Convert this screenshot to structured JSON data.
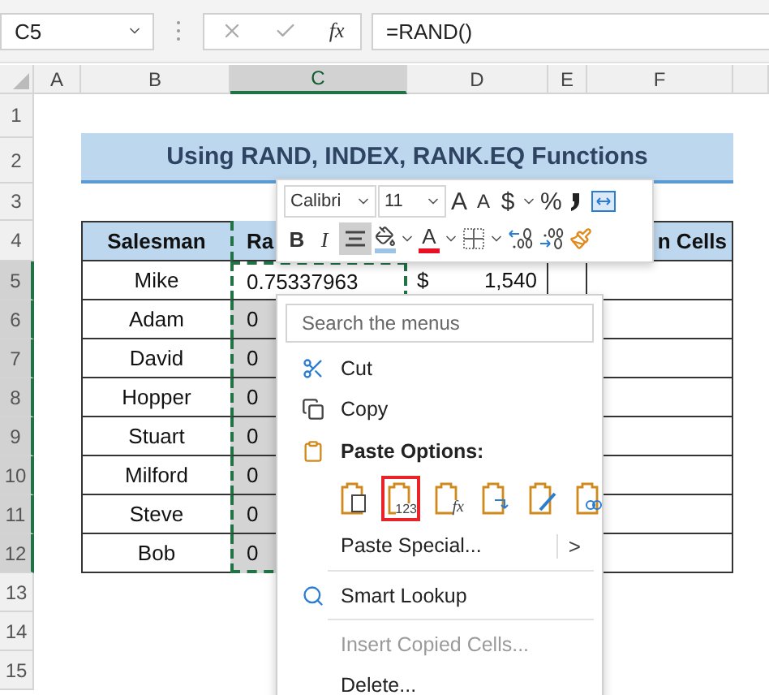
{
  "formula_bar": {
    "name_box": "C5",
    "function_label": "fx",
    "formula": "=RAND()"
  },
  "columns": [
    {
      "label": "A",
      "selected": false
    },
    {
      "label": "B",
      "selected": false
    },
    {
      "label": "C",
      "selected": true
    },
    {
      "label": "D",
      "selected": false
    },
    {
      "label": "E",
      "selected": false
    },
    {
      "label": "F",
      "selected": false
    }
  ],
  "rows": [
    {
      "label": "1",
      "selected": false
    },
    {
      "label": "2",
      "selected": false
    },
    {
      "label": "3",
      "selected": false
    },
    {
      "label": "4",
      "selected": false
    },
    {
      "label": "5",
      "selected": true
    },
    {
      "label": "6",
      "selected": true
    },
    {
      "label": "7",
      "selected": true
    },
    {
      "label": "8",
      "selected": true
    },
    {
      "label": "9",
      "selected": true
    },
    {
      "label": "10",
      "selected": true
    },
    {
      "label": "11",
      "selected": true
    },
    {
      "label": "12",
      "selected": true
    },
    {
      "label": "13",
      "selected": false
    },
    {
      "label": "14",
      "selected": false
    },
    {
      "label": "15",
      "selected": false
    }
  ],
  "title": "Using RAND, INDEX, RANK.EQ Functions",
  "table": {
    "header": {
      "column_b": "Salesman",
      "column_c": "Ra",
      "column_f": "n Cells"
    },
    "rows": [
      {
        "column_b": "Mike",
        "column_c": "0.75337963",
        "column_d_symbol": "$",
        "column_d": "1,540",
        "c_selected": false,
        "c_copied": true
      },
      {
        "column_b": "Adam",
        "column_c": "0",
        "c_selected": true,
        "c_copied": true
      },
      {
        "column_b": "David",
        "column_c": "0",
        "c_selected": true,
        "c_copied": true
      },
      {
        "column_b": "Hopper",
        "column_c": "0",
        "c_selected": true,
        "c_copied": true
      },
      {
        "column_b": "Stuart",
        "column_c": "0",
        "c_selected": true,
        "c_copied": true
      },
      {
        "column_b": "Milford",
        "column_c": "0",
        "c_selected": true,
        "c_copied": true
      },
      {
        "column_b": "Steve",
        "column_c": "0",
        "c_selected": true,
        "c_copied": true
      },
      {
        "column_b": "Bob",
        "column_c": "0",
        "c_selected": true,
        "c_copied": true
      }
    ]
  },
  "mini_toolbar": {
    "font": "Calibri",
    "size": "11",
    "row_1": [
      {
        "kind": "grow",
        "label": "A"
      },
      {
        "kind": "shrink",
        "label": "A"
      },
      {
        "kind": "glyph",
        "label": "$"
      },
      {
        "kind": "caret"
      },
      {
        "kind": "glyph",
        "label": "%"
      },
      {
        "kind": "comma"
      },
      {
        "kind": "merge"
      }
    ],
    "row_2": [
      {
        "kind": "bold",
        "label": "B",
        "selected": false
      },
      {
        "kind": "italic",
        "label": "I",
        "selected": false
      },
      {
        "kind": "center",
        "selected": true
      },
      {
        "kind": "fill"
      },
      {
        "kind": "caret"
      },
      {
        "kind": "fontcolor",
        "label": "A"
      },
      {
        "kind": "caret"
      },
      {
        "kind": "borders"
      },
      {
        "kind": "caret"
      },
      {
        "kind": "incdec"
      },
      {
        "kind": "decdec"
      },
      {
        "kind": "painter"
      }
    ]
  },
  "context_menu": {
    "search": {
      "placeholder": "Search the menus"
    },
    "items": [
      {
        "kind": "cut",
        "label": "Cut",
        "disabled": false
      },
      {
        "kind": "copy",
        "label": "Copy",
        "disabled": false
      },
      {
        "kind": "paste_header",
        "label": "Paste Options:"
      },
      {
        "kind": "paste_icons",
        "options": [
          {
            "kind": "paste",
            "selected": false
          },
          {
            "kind": "values",
            "label": "123",
            "selected": true
          },
          {
            "kind": "formulas",
            "label": "fx",
            "selected": false
          },
          {
            "kind": "transpose",
            "selected": false
          },
          {
            "kind": "formatting",
            "selected": false
          },
          {
            "kind": "link",
            "selected": false
          }
        ]
      },
      {
        "kind": "submenu",
        "label": "Paste Special...",
        "arrow": ">",
        "disabled": false
      },
      {
        "kind": "separator"
      },
      {
        "kind": "lookup",
        "label": "Smart Lookup",
        "disabled": false
      },
      {
        "kind": "separator"
      },
      {
        "kind": "plain",
        "label": "Insert Copied Cells...",
        "disabled": true
      },
      {
        "kind": "plain",
        "label": "Delete...",
        "disabled": false
      }
    ]
  }
}
